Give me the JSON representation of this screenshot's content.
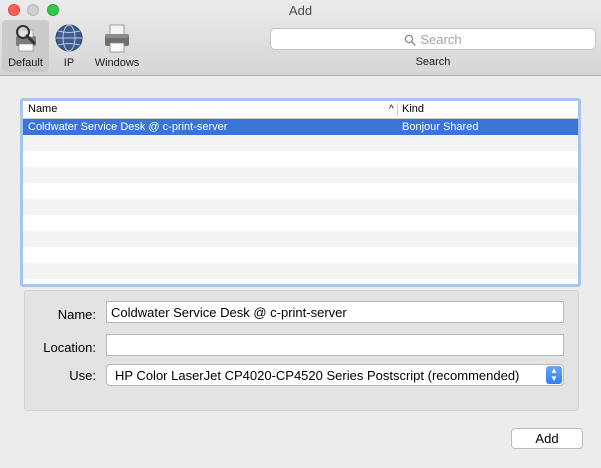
{
  "window": {
    "title": "Add"
  },
  "toolbar": {
    "buttons": [
      {
        "label": "Default",
        "icon": "printer-search-icon",
        "selected": true
      },
      {
        "label": "IP",
        "icon": "globe-icon",
        "selected": false
      },
      {
        "label": "Windows",
        "icon": "printer-icon",
        "selected": false
      }
    ],
    "search": {
      "placeholder": "Search",
      "caption": "Search"
    }
  },
  "table": {
    "columns": [
      "Name",
      "Kind"
    ],
    "sort_indicator": "^",
    "rows": [
      {
        "name": "Coldwater Service Desk @ c-print-server",
        "kind": "Bonjour Shared",
        "selected": true
      }
    ]
  },
  "form": {
    "name_label": "Name:",
    "name_value": "Coldwater Service Desk @ c-print-server",
    "location_label": "Location:",
    "location_value": "",
    "use_label": "Use:",
    "use_value": "HP Color LaserJet CP4020-CP4520 Series Postscript (recommended)"
  },
  "footer": {
    "add_label": "Add"
  },
  "colors": {
    "selection": "#3a74d8",
    "focus_ring": "#a6c4ec",
    "accent": "#2f7ef3"
  }
}
